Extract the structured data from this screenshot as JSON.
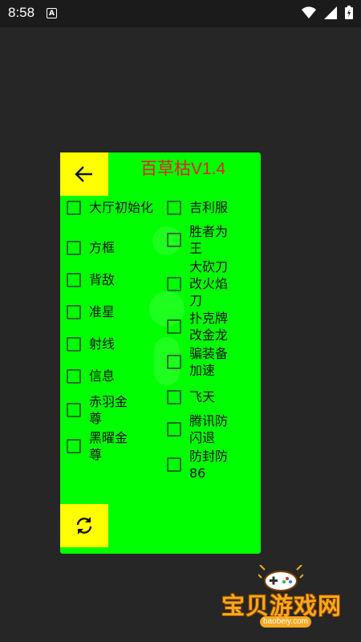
{
  "status_bar": {
    "time": "8:58",
    "notification_letter": "A"
  },
  "panel": {
    "title": "百草枯V1.4",
    "left_options": [
      {
        "label": "大厅初始化"
      },
      {
        "label": "方框"
      },
      {
        "label": "背敌"
      },
      {
        "label": "准星"
      },
      {
        "label": "射线"
      },
      {
        "label": "信息"
      },
      {
        "label": "赤羽金\n尊"
      },
      {
        "label": "黑曜金\n尊"
      }
    ],
    "right_options": [
      {
        "label": "吉利服"
      },
      {
        "label": "胜者为\n王"
      },
      {
        "label": "大砍刀\n改火焰\n刀"
      },
      {
        "label": "扑克牌\n改金龙"
      },
      {
        "label": "骗装备\n加速"
      },
      {
        "label": "飞天"
      },
      {
        "label": "腾讯防\n闪退"
      },
      {
        "label": "防封防\n86"
      }
    ],
    "colors": {
      "panel_bg": "#00ff00",
      "button_bg": "#ffff00",
      "title": "#e8202a"
    }
  },
  "watermark_logo": {
    "chinese": "宝贝游戏网",
    "url": "baobeiy.com"
  }
}
